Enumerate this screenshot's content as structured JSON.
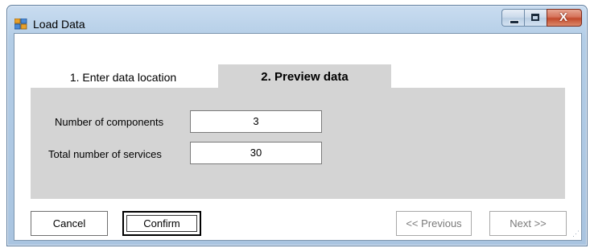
{
  "window": {
    "title": "Load Data"
  },
  "tabs": [
    {
      "label": "1. Enter data location"
    },
    {
      "label": "2. Preview data",
      "selected": true
    }
  ],
  "form": {
    "components": {
      "label": "Number of components",
      "value": "3"
    },
    "services": {
      "label": "Total number of services",
      "value": "30"
    }
  },
  "buttons": {
    "cancel": "Cancel",
    "confirm": "Confirm",
    "previous": "<< Previous",
    "next": "Next >>"
  },
  "window_controls": {
    "close_glyph": "X"
  },
  "colors": {
    "title_gradient": "#b3cde6",
    "panel_bg": "#d4d4d4",
    "close_button": "#c24a2c"
  }
}
